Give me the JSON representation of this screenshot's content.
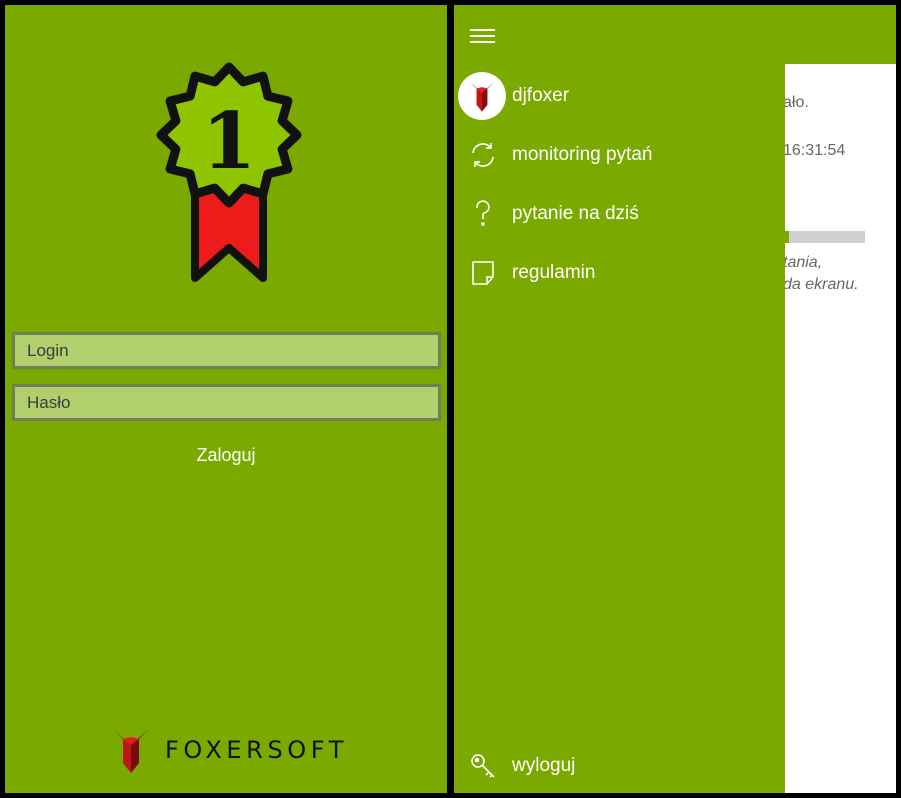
{
  "login_screen": {
    "badge": {
      "number": "1"
    },
    "login_placeholder": "Login",
    "password_placeholder": "Hasło",
    "login_button": "Zaloguj",
    "brand_name": "FOXERSOFT"
  },
  "app_screen": {
    "drawer": {
      "user": {
        "name": "djfoxer"
      },
      "items": [
        {
          "label": "monitoring pytań",
          "icon": "refresh-icon"
        },
        {
          "label": "pytanie na dziś",
          "icon": "question-icon"
        },
        {
          "label": "regulamin",
          "icon": "document-icon"
        }
      ],
      "logout": {
        "label": "wyloguj",
        "icon": "key-icon"
      }
    },
    "content_peek": {
      "line1": "ało.",
      "line2": "16:31:54",
      "line3": "tania,",
      "line4": "da ekranu."
    }
  },
  "colors": {
    "primary_green": "#7aaa00",
    "field_bg": "#b1cf6d",
    "badge_green": "#8fc400",
    "ribbon_red": "#ee1b1b"
  }
}
